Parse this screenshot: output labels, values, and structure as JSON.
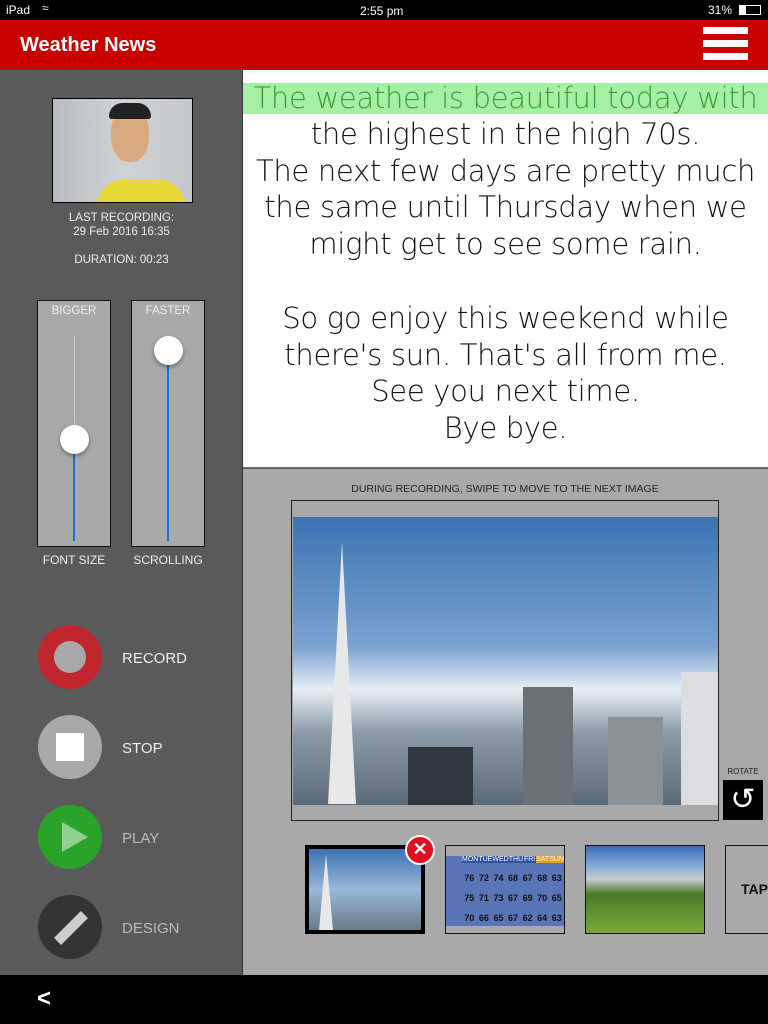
{
  "status_bar": {
    "device": "iPad",
    "time": "2:55 pm",
    "battery": "31%"
  },
  "header": {
    "title": "Weather News",
    "menu_icon": "hamburger-icon"
  },
  "sidebar": {
    "last_recording_label": "LAST RECORDING:",
    "last_recording_date": "29 Feb 2016 16:35",
    "duration": "DURATION: 00:23",
    "sliders": [
      {
        "top_label": "BIGGER",
        "bottom_label": "FONT SIZE",
        "value": 0.5
      },
      {
        "top_label": "FASTER",
        "bottom_label": "SCROLLING",
        "value": 0.93
      }
    ],
    "buttons": [
      {
        "label": "RECORD",
        "icon": "record-icon",
        "color": "#c0262d"
      },
      {
        "label": "STOP",
        "icon": "stop-icon",
        "color": "#a9a9a9"
      },
      {
        "label": "PLAY",
        "icon": "play-icon",
        "color": "#2aa32a"
      },
      {
        "label": "DESIGN",
        "icon": "pencil-icon",
        "color": "#333333"
      }
    ]
  },
  "script": {
    "highlight_color": "#a6f0a6",
    "lines": [
      "The weather is beautiful today with",
      "the highest in the high 70s.",
      "The next few days are pretty much",
      "the same until Thursday when we",
      "might get to see some rain.",
      "",
      "So go enjoy this weekend while",
      "there's sun. That's all from me.",
      "See you next time.",
      "Bye bye."
    ]
  },
  "images": {
    "hint": "DURING RECORDING, SWIPE TO MOVE TO THE NEXT IMAGE",
    "rotate_label": "ROTATE",
    "tap_label": "TAP",
    "forecast": {
      "days": [
        "MON",
        "TUE",
        "WED",
        "THU",
        "FRI",
        "SAT",
        "SUN"
      ],
      "rows": [
        [
          "76",
          "72",
          "74",
          "68",
          "67",
          "68",
          "63"
        ],
        [
          "75",
          "71",
          "73",
          "67",
          "69",
          "70",
          "65"
        ],
        [
          "70",
          "66",
          "65",
          "67",
          "62",
          "64",
          "63"
        ]
      ]
    }
  },
  "nav": {
    "back_label": "<"
  }
}
